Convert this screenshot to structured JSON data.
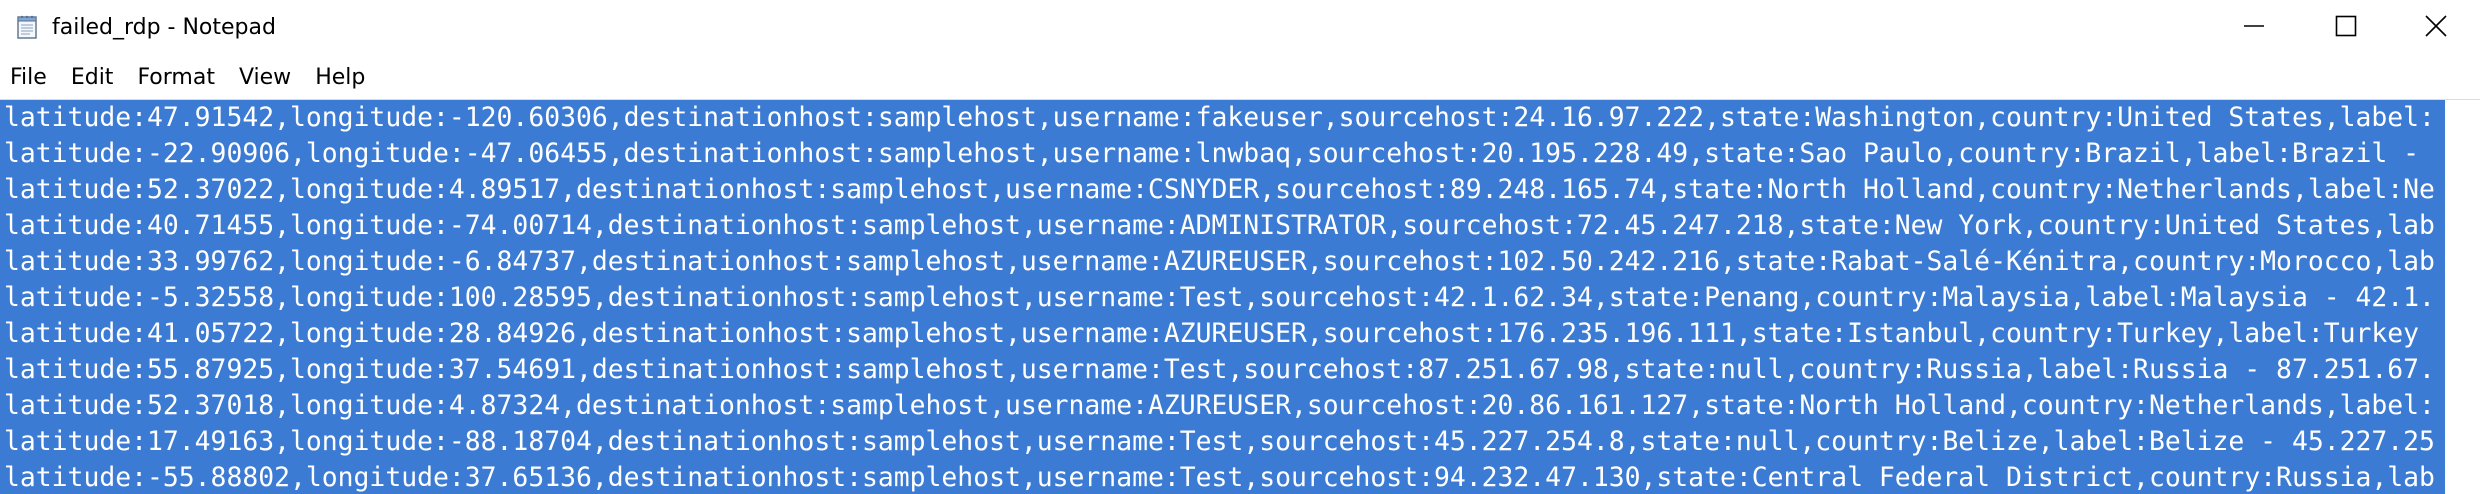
{
  "window": {
    "title": "failed_rdp - Notepad"
  },
  "menu": {
    "items": [
      "File",
      "Edit",
      "Format",
      "View",
      "Help"
    ]
  },
  "editor": {
    "selection_color": "#3b7bd4",
    "lines": [
      "latitude:47.91542,longitude:-120.60306,destinationhost:samplehost,username:fakeuser,sourcehost:24.16.97.222,state:Washington,country:United States,label:",
      "latitude:-22.90906,longitude:-47.06455,destinationhost:samplehost,username:lnwbaq,sourcehost:20.195.228.49,state:Sao Paulo,country:Brazil,label:Brazil -",
      "latitude:52.37022,longitude:4.89517,destinationhost:samplehost,username:CSNYDER,sourcehost:89.248.165.74,state:North Holland,country:Netherlands,label:Ne",
      "latitude:40.71455,longitude:-74.00714,destinationhost:samplehost,username:ADMINISTRATOR,sourcehost:72.45.247.218,state:New York,country:United States,lab",
      "latitude:33.99762,longitude:-6.84737,destinationhost:samplehost,username:AZUREUSER,sourcehost:102.50.242.216,state:Rabat-Salé-Kénitra,country:Morocco,lab",
      "latitude:-5.32558,longitude:100.28595,destinationhost:samplehost,username:Test,sourcehost:42.1.62.34,state:Penang,country:Malaysia,label:Malaysia - 42.1.",
      "latitude:41.05722,longitude:28.84926,destinationhost:samplehost,username:AZUREUSER,sourcehost:176.235.196.111,state:Istanbul,country:Turkey,label:Turkey",
      "latitude:55.87925,longitude:37.54691,destinationhost:samplehost,username:Test,sourcehost:87.251.67.98,state:null,country:Russia,label:Russia - 87.251.67.",
      "latitude:52.37018,longitude:4.87324,destinationhost:samplehost,username:AZUREUSER,sourcehost:20.86.161.127,state:North Holland,country:Netherlands,label:",
      "latitude:17.49163,longitude:-88.18704,destinationhost:samplehost,username:Test,sourcehost:45.227.254.8,state:null,country:Belize,label:Belize - 45.227.25",
      "latitude:-55.88802,longitude:37.65136,destinationhost:samplehost,username:Test,sourcehost:94.232.47.130,state:Central Federal District,country:Russia,lab"
    ]
  },
  "icons": {
    "app": "notepad-icon",
    "minimize": "minimize-icon",
    "maximize": "maximize-icon",
    "close": "close-icon"
  }
}
